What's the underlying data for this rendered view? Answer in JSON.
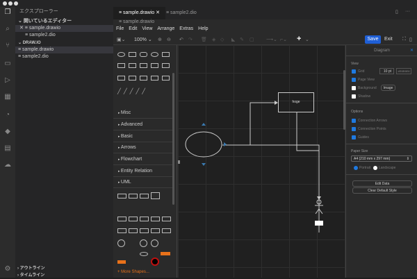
{
  "window": {
    "title": "sample.drawio"
  },
  "sidebar": {
    "title": "エクスプローラー",
    "open_editors": "開いているエディター",
    "open_files": [
      "sample.drawio",
      "sample2.dio"
    ],
    "section": "DRAW.IO",
    "files": [
      "sample.drawio",
      "sample2.dio"
    ],
    "outline": "アウトライン",
    "timeline": "タイムライン"
  },
  "tabs": [
    {
      "label": "sample.drawio"
    },
    {
      "label": "sample2.dio"
    }
  ],
  "breadcrumb": "sample.drawio",
  "menu": [
    "File",
    "Edit",
    "View",
    "Arrange",
    "Extras",
    "Help"
  ],
  "toolbar": {
    "zoom": "100%",
    "save": "Save",
    "exit": "Exit"
  },
  "shapes": {
    "categories": [
      "Misc",
      "Advanced",
      "Basic",
      "Arrows",
      "Flowchart",
      "Entity Relation",
      "UML"
    ],
    "more": "+ More Shapes..."
  },
  "canvas": {
    "box_label": "hoge"
  },
  "format": {
    "title": "Diagram",
    "view": "View",
    "grid": "Grid",
    "grid_size": "10 pt",
    "grid_color": "#E6E6E6",
    "page_view": "Page View",
    "background": "Background",
    "image": "Image",
    "shadow": "Shadow",
    "options": "Options",
    "connection_arrows": "Connection Arrows",
    "connection_points": "Connection Points",
    "guides": "Guides",
    "paper_size": "Paper Size",
    "paper_value": "A4 (210 mm x 297 mm)",
    "portrait": "Portrait",
    "landscape": "Landscape",
    "edit_data": "Edit Data",
    "clear_style": "Clear Default Style"
  },
  "colors": {
    "accent": "#1f7ae0",
    "more_shapes": "#e8711a"
  }
}
